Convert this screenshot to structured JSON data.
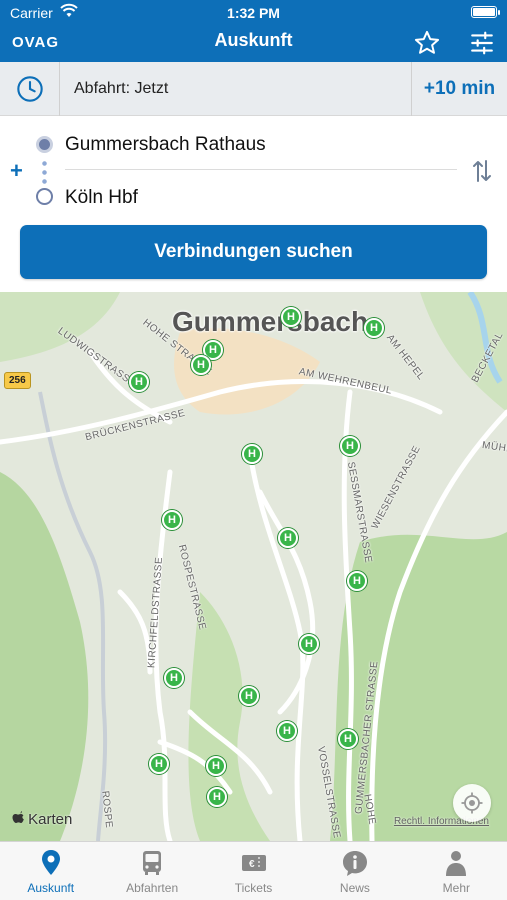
{
  "status": {
    "carrier": "Carrier",
    "time": "1:32 PM"
  },
  "nav": {
    "logo": "OVAG",
    "title": "Auskunft"
  },
  "time_selector": {
    "departure": "Abfahrt: Jetzt",
    "plus": "+10 min"
  },
  "route": {
    "from": "Gummersbach Rathaus",
    "to": "Köln Hbf",
    "search_button": "Verbindungen suchen"
  },
  "map": {
    "place_label": "Gummersbach",
    "road_number": "256",
    "streets": [
      "Hohe Straße",
      "Ludwigstraße",
      "Brückenstraße",
      "Am Wehrenbeul",
      "Am Hepel",
      "Seßmarstraße",
      "Wiesenstraße",
      "Kirchfeldstraße",
      "Rospestraße",
      "Gummersbacher Straße",
      "Vosselstraße",
      "Becketal",
      "Mühl",
      "Hohe",
      "Rospe"
    ],
    "stop_symbol": "H",
    "attribution": "Karten",
    "legal": "Rechtl. Informationen"
  },
  "tabs": [
    {
      "label": "Auskunft",
      "icon": "location-pin-icon",
      "active": true
    },
    {
      "label": "Abfahrten",
      "icon": "bus-icon",
      "active": false
    },
    {
      "label": "Tickets",
      "icon": "ticket-icon",
      "active": false
    },
    {
      "label": "News",
      "icon": "info-icon",
      "active": false
    },
    {
      "label": "Mehr",
      "icon": "person-icon",
      "active": false
    }
  ],
  "colors": {
    "primary": "#0d6fb8",
    "stop": "#39b54a",
    "tab_inactive": "#888888"
  }
}
